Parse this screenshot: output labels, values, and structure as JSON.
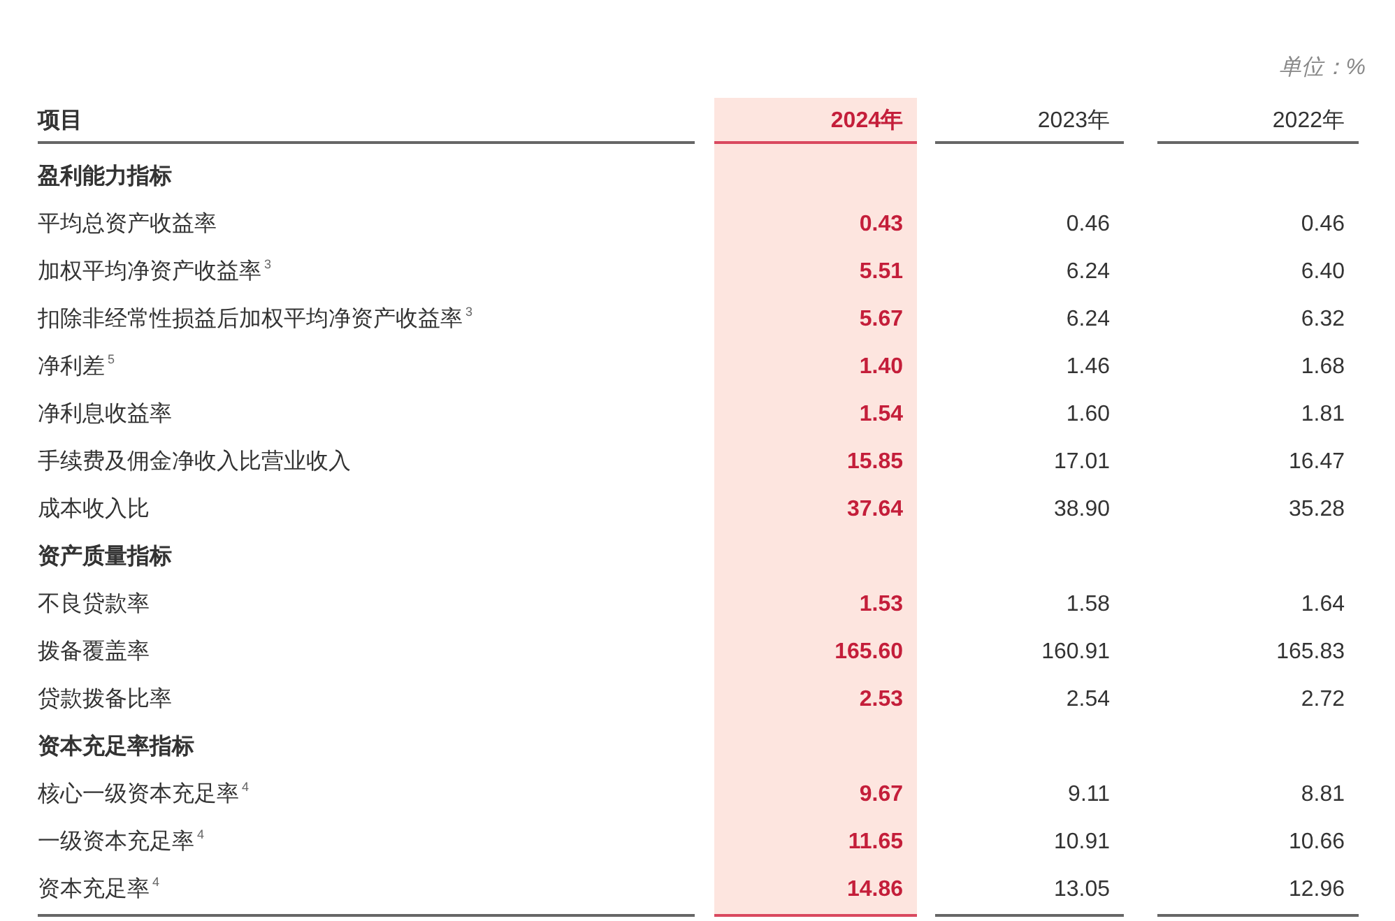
{
  "unit": "单位：%",
  "columns": [
    {
      "label": "项目",
      "highlighted": false
    },
    {
      "label": "2024年",
      "highlighted": true
    },
    {
      "label": "2023年",
      "highlighted": false
    },
    {
      "label": "2022年",
      "highlighted": false
    }
  ],
  "rows": [
    {
      "kind": "section",
      "label": "盈利能力指标"
    },
    {
      "kind": "item",
      "label": "平均总资产收益率",
      "values": [
        "0.43",
        "0.46",
        "0.46"
      ]
    },
    {
      "kind": "item",
      "label": "加权平均净资产收益率$^{3}$",
      "values": [
        "5.51",
        "6.24",
        "6.40"
      ]
    },
    {
      "kind": "item",
      "label": "扣除非经常性损益后加权平均净资产收益率$^{3}$",
      "values": [
        "5.67",
        "6.24",
        "6.32"
      ]
    },
    {
      "kind": "item",
      "label": "净利差$^{5}$",
      "values": [
        "1.40",
        "1.46",
        "1.68"
      ]
    },
    {
      "kind": "item",
      "label": "净利息收益率",
      "values": [
        "1.54",
        "1.60",
        "1.81"
      ]
    },
    {
      "kind": "item",
      "label": "手续费及佣金净收入比营业收入",
      "values": [
        "15.85",
        "17.01",
        "16.47"
      ]
    },
    {
      "kind": "item",
      "label": "成本收入比",
      "values": [
        "37.64",
        "38.90",
        "35.28"
      ]
    },
    {
      "kind": "section",
      "label": "资产质量指标"
    },
    {
      "kind": "item",
      "label": "不良贷款率",
      "values": [
        "1.53",
        "1.58",
        "1.64"
      ]
    },
    {
      "kind": "item",
      "label": "拨备覆盖率",
      "values": [
        "165.60",
        "160.91",
        "165.83"
      ]
    },
    {
      "kind": "item",
      "label": "贷款拨备比率",
      "values": [
        "2.53",
        "2.54",
        "2.72"
      ]
    },
    {
      "kind": "section",
      "label": "资本充足率指标"
    },
    {
      "kind": "item",
      "label": "核心一级资本充足率$^{4}$",
      "values": [
        "9.67",
        "9.11",
        "8.81"
      ]
    },
    {
      "kind": "item",
      "label": "一级资本充足率$^{4}$",
      "values": [
        "11.65",
        "10.91",
        "10.66"
      ]
    },
    {
      "kind": "item",
      "label": "资本充足率$^{4}$",
      "values": [
        "14.86",
        "13.05",
        "12.96"
      ]
    }
  ]
}
